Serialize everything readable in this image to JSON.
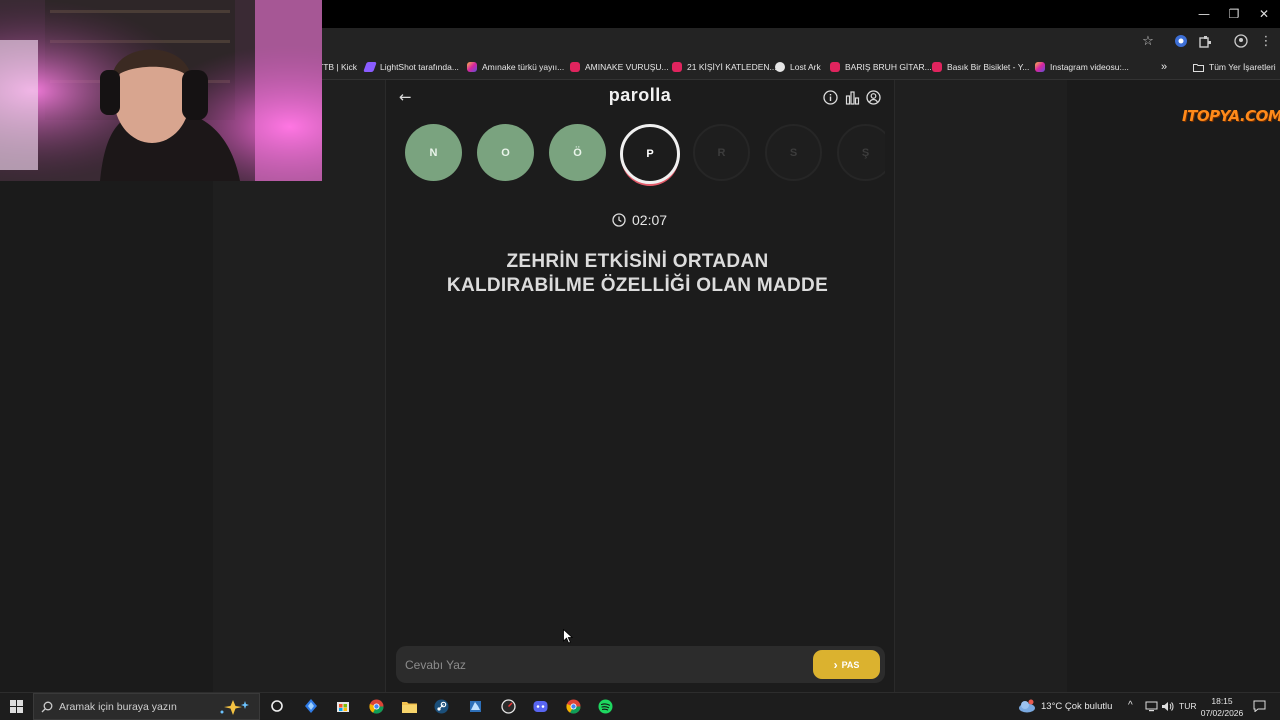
{
  "browser": {
    "bookmarks": [
      {
        "label": "TTB | Kick",
        "icon": "kick-icon"
      },
      {
        "label": "LightShot tarafında...",
        "icon": "lightshot-icon"
      },
      {
        "label": "Amınake türkü yayıı...",
        "icon": "instagram-icon"
      },
      {
        "label": "AMINAKE VURUŞU...",
        "icon": "youtube-icon"
      },
      {
        "label": "21 KİŞİYİ KATLEDEN...",
        "icon": "youtube-icon"
      },
      {
        "label": "Lost Ark",
        "icon": "globe-icon"
      },
      {
        "label": "BARIŞ BRUH GİTAR...",
        "icon": "youtube-icon"
      },
      {
        "label": "Basık Bir Bisiklet - Y...",
        "icon": "youtube-icon"
      },
      {
        "label": "Instagram videosu:...",
        "icon": "instagram-icon"
      }
    ],
    "all_bookmarks_label": "Tüm Yer İşaretleri",
    "more_bookmarks_glyph": "»"
  },
  "app": {
    "title": "parolla",
    "back_glyph": "←",
    "letters": [
      {
        "letter": "N",
        "state": "done"
      },
      {
        "letter": "O",
        "state": "done"
      },
      {
        "letter": "Ö",
        "state": "done"
      },
      {
        "letter": "P",
        "state": "active"
      },
      {
        "letter": "R",
        "state": "pending"
      },
      {
        "letter": "S",
        "state": "pending"
      },
      {
        "letter": "Ş",
        "state": "pending"
      }
    ],
    "timer": "02:07",
    "question_line1": "ZEHRİN ETKİSİNİ ORTADAN",
    "question_line2": "KALDIRABİLME ÖZELLİĞİ OLAN MADDE",
    "answer_placeholder": "Cevabı Yaz",
    "pass_label": "PAS",
    "pass_glyph": "›",
    "colors": {
      "done": "#7aa37f",
      "pass": "#dbb22f",
      "active_ring": "#e35b6a"
    }
  },
  "watermark": "ITOPYA.COM",
  "taskbar": {
    "search_placeholder": "Aramak için buraya yazın",
    "weather": "13°C  Çok bulutlu",
    "language": "TUR",
    "time": "18:15",
    "date": "07/02/2026"
  }
}
